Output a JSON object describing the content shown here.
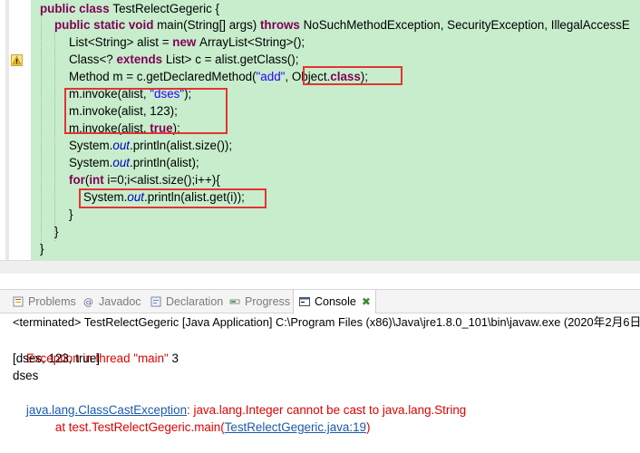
{
  "editor": {
    "lines": [
      {
        "id": "class-decl",
        "parts": [
          {
            "t": "kw",
            "v": "public "
          },
          {
            "t": "kw",
            "v": "class "
          },
          {
            "t": "n",
            "v": "TestRelectGegeric {"
          }
        ]
      },
      {
        "id": "main-decl",
        "parts": [
          {
            "t": "kw",
            "v": "public "
          },
          {
            "t": "kw",
            "v": "static "
          },
          {
            "t": "kw",
            "v": "void "
          },
          {
            "t": "n",
            "v": "main(String[] args) "
          },
          {
            "t": "kw",
            "v": "throws "
          },
          {
            "t": "n",
            "v": "NoSuchMethodException, SecurityException, IllegalAccessE"
          }
        ]
      },
      {
        "id": "list-decl",
        "parts": [
          {
            "t": "n",
            "v": "List<String> alist = "
          },
          {
            "t": "kw",
            "v": "new "
          },
          {
            "t": "n",
            "v": "ArrayList<String>();"
          }
        ]
      },
      {
        "id": "class-var",
        "parts": [
          {
            "t": "n",
            "v": "Class<? "
          },
          {
            "t": "kw",
            "v": "extends "
          },
          {
            "t": "n",
            "v": "List> c = alist.getClass();"
          }
        ]
      },
      {
        "id": "method-decl",
        "parts": [
          {
            "t": "n",
            "v": "Method m = c.getDeclaredMethod("
          },
          {
            "t": "str",
            "v": "\"add\""
          },
          {
            "t": "n",
            "v": ", Object."
          },
          {
            "t": "kw",
            "v": "class"
          },
          {
            "t": "n",
            "v": ");"
          }
        ]
      },
      {
        "id": "invoke-string",
        "parts": [
          {
            "t": "n",
            "v": "m.invoke(alist, "
          },
          {
            "t": "str",
            "v": "\"dses\""
          },
          {
            "t": "n",
            "v": ");"
          }
        ]
      },
      {
        "id": "invoke-int",
        "parts": [
          {
            "t": "n",
            "v": "m.invoke(alist, 123);"
          }
        ]
      },
      {
        "id": "invoke-bool",
        "parts": [
          {
            "t": "n",
            "v": "m.invoke(alist, "
          },
          {
            "t": "kw",
            "v": "true"
          },
          {
            "t": "n",
            "v": ");"
          }
        ]
      },
      {
        "id": "print-size",
        "parts": [
          {
            "t": "n",
            "v": "System."
          },
          {
            "t": "fld",
            "v": "out"
          },
          {
            "t": "n",
            "v": ".println(alist.size());"
          }
        ]
      },
      {
        "id": "print-list",
        "parts": [
          {
            "t": "n",
            "v": "System."
          },
          {
            "t": "fld",
            "v": "out"
          },
          {
            "t": "n",
            "v": ".println(alist);"
          }
        ]
      },
      {
        "id": "for-loop",
        "parts": [
          {
            "t": "kw",
            "v": "for"
          },
          {
            "t": "n",
            "v": "("
          },
          {
            "t": "kw",
            "v": "int "
          },
          {
            "t": "n",
            "v": "i=0;i<alist.size();i++){"
          }
        ]
      },
      {
        "id": "print-get",
        "parts": [
          {
            "t": "n",
            "v": "System."
          },
          {
            "t": "fld",
            "v": "out"
          },
          {
            "t": "n",
            "v": ".println(alist.get(i));"
          }
        ]
      },
      {
        "id": "close-for",
        "parts": [
          {
            "t": "n",
            "v": "}"
          }
        ]
      },
      {
        "id": "close-main",
        "parts": [
          {
            "t": "n",
            "v": "}"
          }
        ]
      },
      {
        "id": "close-class",
        "parts": [
          {
            "t": "n",
            "v": "}"
          }
        ]
      }
    ]
  },
  "tabs": [
    {
      "id": "problems",
      "label": "Problems",
      "icon": "problems-icon",
      "active": false
    },
    {
      "id": "javadoc",
      "label": "Javadoc",
      "icon": "at-sign-icon",
      "active": false
    },
    {
      "id": "declaration",
      "label": "Declaration",
      "icon": "declaration-icon",
      "active": false
    },
    {
      "id": "progress",
      "label": "Progress",
      "icon": "progress-icon",
      "active": false
    },
    {
      "id": "console",
      "label": "Console",
      "icon": "console-icon",
      "active": true
    }
  ],
  "console": {
    "header": "<terminated> TestRelectGegeric [Java Application] C:\\Program Files (x86)\\Java\\jre1.8.0_101\\bin\\javaw.exe (2020年2月6日",
    "exception_prefix": "Exception in thread \"main\" ",
    "exception_value": "3",
    "out_list": "[dses, 123, true]",
    "out_first": "dses",
    "cce_link": "java.lang.ClassCastException",
    "cce_message": ": java.lang.Integer cannot be cast to java.lang.String",
    "stack_prefix": "at test.TestRelectGegeric.main(",
    "stack_link": "TestRelectGegeric.java:19",
    "stack_suffix": ")"
  },
  "colors": {
    "editor_bg": "#c7edcc",
    "keyword": "#7f0055",
    "string": "#2a00ff",
    "field": "#0000c0",
    "error": "#e00000",
    "link": "#1a5aa8",
    "highlight_box": "#e53333"
  }
}
